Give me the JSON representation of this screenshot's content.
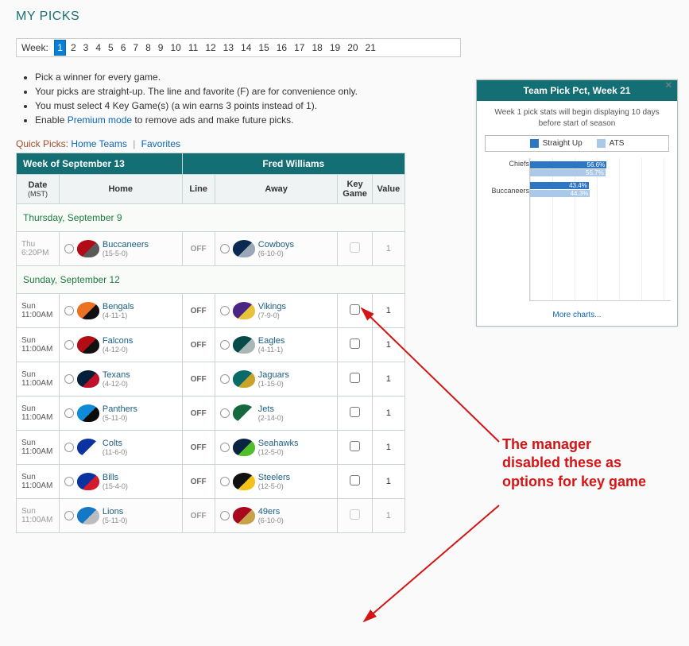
{
  "page_title": "MY PICKS",
  "week_label": "Week:",
  "weeks": [
    1,
    2,
    3,
    4,
    5,
    6,
    7,
    8,
    9,
    10,
    11,
    12,
    13,
    14,
    15,
    16,
    17,
    18,
    19,
    20,
    21
  ],
  "active_week": 1,
  "instructions": [
    "Pick a winner for every game.",
    "Your picks are straight-up. The line and favorite (F) are for convenience only.",
    "You must select 4 Key Game(s) (a win earns 3 points instead of 1).",
    "Enable ___LINK___ to remove ads and make future picks."
  ],
  "premium_link_text": "Premium mode",
  "quick_picks": {
    "label": "Quick Picks:",
    "home": "Home Teams",
    "fav": "Favorites"
  },
  "header": {
    "week_of": "Week of September 13",
    "user": "Fred Williams"
  },
  "columns": {
    "date": "Date",
    "tz": "(MST)",
    "home": "Home",
    "line": "Line",
    "away": "Away",
    "key": "Key Game",
    "value": "Value"
  },
  "sections": [
    {
      "label": "Thursday, September 9",
      "games": [
        {
          "dow": "Thu",
          "time": "6:20PM",
          "home": {
            "name": "Buccaneers",
            "rec": "(15-5-0)",
            "c1": "#b10b15",
            "c2": "#5a5a5a"
          },
          "line": "OFF",
          "away": {
            "name": "Cowboys",
            "rec": "(6-10-0)",
            "c1": "#0a2a52",
            "c2": "#9aa7b6"
          },
          "key_disabled": true,
          "value": "1"
        }
      ]
    },
    {
      "label": "Sunday, September 12",
      "games": [
        {
          "dow": "Sun",
          "time": "11:00AM",
          "home": {
            "name": "Bengals",
            "rec": "(4-11-1)",
            "c1": "#ea7221",
            "c2": "#111"
          },
          "line": "OFF",
          "away": {
            "name": "Vikings",
            "rec": "(7-9-0)",
            "c1": "#4a2583",
            "c2": "#e6c33a"
          },
          "key_disabled": false,
          "value": "1"
        },
        {
          "dow": "Sun",
          "time": "11:00AM",
          "home": {
            "name": "Falcons",
            "rec": "(4-12-0)",
            "c1": "#b00d17",
            "c2": "#111"
          },
          "line": "OFF",
          "away": {
            "name": "Eagles",
            "rec": "(4-11-1)",
            "c1": "#064b49",
            "c2": "#a7b7b6"
          },
          "key_disabled": false,
          "value": "1"
        },
        {
          "dow": "Sun",
          "time": "11:00AM",
          "home": {
            "name": "Texans",
            "rec": "(4-12-0)",
            "c1": "#07203a",
            "c2": "#c0102a"
          },
          "line": "OFF",
          "away": {
            "name": "Jaguars",
            "rec": "(1-15-0)",
            "c1": "#0a6a67",
            "c2": "#caa32a"
          },
          "key_disabled": false,
          "value": "1"
        },
        {
          "dow": "Sun",
          "time": "11:00AM",
          "home": {
            "name": "Panthers",
            "rec": "(5-11-0)",
            "c1": "#0d8bd8",
            "c2": "#0b0b0b"
          },
          "line": "OFF",
          "away": {
            "name": "Jets",
            "rec": "(2-14-0)",
            "c1": "#146a3c",
            "c2": "#ffffff"
          },
          "key_disabled": false,
          "value": "1"
        },
        {
          "dow": "Sun",
          "time": "11:00AM",
          "home": {
            "name": "Colts",
            "rec": "(11-6-0)",
            "c1": "#0a32a0",
            "c2": "#ffffff"
          },
          "line": "OFF",
          "away": {
            "name": "Seahawks",
            "rec": "(12-5-0)",
            "c1": "#0a2342",
            "c2": "#4fbf2a"
          },
          "key_disabled": false,
          "value": "1"
        },
        {
          "dow": "Sun",
          "time": "11:00AM",
          "home": {
            "name": "Bills",
            "rec": "(15-4-0)",
            "c1": "#0a32a0",
            "c2": "#d41b2d"
          },
          "line": "OFF",
          "away": {
            "name": "Steelers",
            "rec": "(12-5-0)",
            "c1": "#111",
            "c2": "#f2c21a"
          },
          "key_disabled": false,
          "value": "1"
        },
        {
          "dow": "Sun",
          "time": "11:00AM",
          "home": {
            "name": "Lions",
            "rec": "(5-11-0)",
            "c1": "#1478c9",
            "c2": "#bcbcbc"
          },
          "line": "OFF",
          "away": {
            "name": "49ers",
            "rec": "(6-10-0)",
            "c1": "#a8081d",
            "c2": "#c8a24a"
          },
          "key_disabled": true,
          "value": "1"
        }
      ]
    }
  ],
  "panel": {
    "title": "Team Pick Pct, Week 21",
    "sub": "Week 1 pick stats will begin displaying 10 days before start of season",
    "legend": {
      "su": "Straight Up",
      "ats": "ATS"
    },
    "more": "More charts..."
  },
  "chart_data": {
    "type": "bar",
    "orientation": "horizontal",
    "categories": [
      "Chiefs",
      "Buccaneers"
    ],
    "series": [
      {
        "name": "Straight Up",
        "color": "#2d77c2",
        "values": [
          56.6,
          43.4
        ]
      },
      {
        "name": "ATS",
        "color": "#aac8e8",
        "values": [
          55.7,
          44.3
        ]
      }
    ],
    "xlim": [
      0,
      100
    ],
    "value_suffix": "%"
  },
  "annotation": "The manager disabled these as options for key game"
}
